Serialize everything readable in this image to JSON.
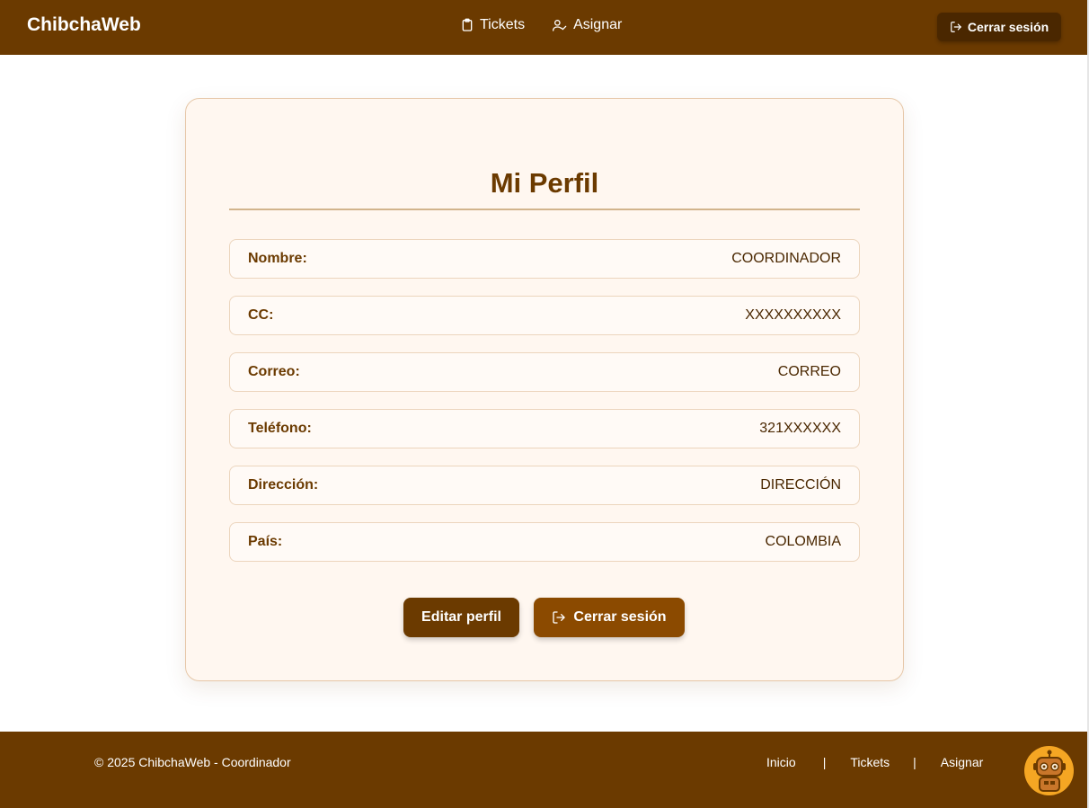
{
  "header": {
    "brand": "ChibchaWeb",
    "nav": [
      {
        "label": "Tickets",
        "icon": "clipboard-icon"
      },
      {
        "label": "Asignar",
        "icon": "user-check-icon"
      }
    ],
    "logout_label": "Cerrar sesión"
  },
  "profile": {
    "title": "Mi Perfil",
    "fields": [
      {
        "label": "Nombre:",
        "value": "COORDINADOR"
      },
      {
        "label": "CC:",
        "value": "XXXXXXXXXX"
      },
      {
        "label": "Correo:",
        "value": "CORREO"
      },
      {
        "label": "Teléfono:",
        "value": "321XXXXXX"
      },
      {
        "label": "Dirección:",
        "value": "DIRECCIÓN"
      },
      {
        "label": "País:",
        "value": "COLOMBIA"
      }
    ],
    "edit_label": "Editar perfil",
    "logout_label": "Cerrar sesión"
  },
  "footer": {
    "copyright": "© 2025 ChibchaWeb - Coordinador",
    "links": [
      "Inicio",
      "Tickets",
      "Asignar"
    ],
    "separator": "|"
  },
  "colors": {
    "primary": "#6b3a00",
    "card_bg": "#fff7f0",
    "accent": "#8b4a00",
    "bot": "#f5a623"
  }
}
